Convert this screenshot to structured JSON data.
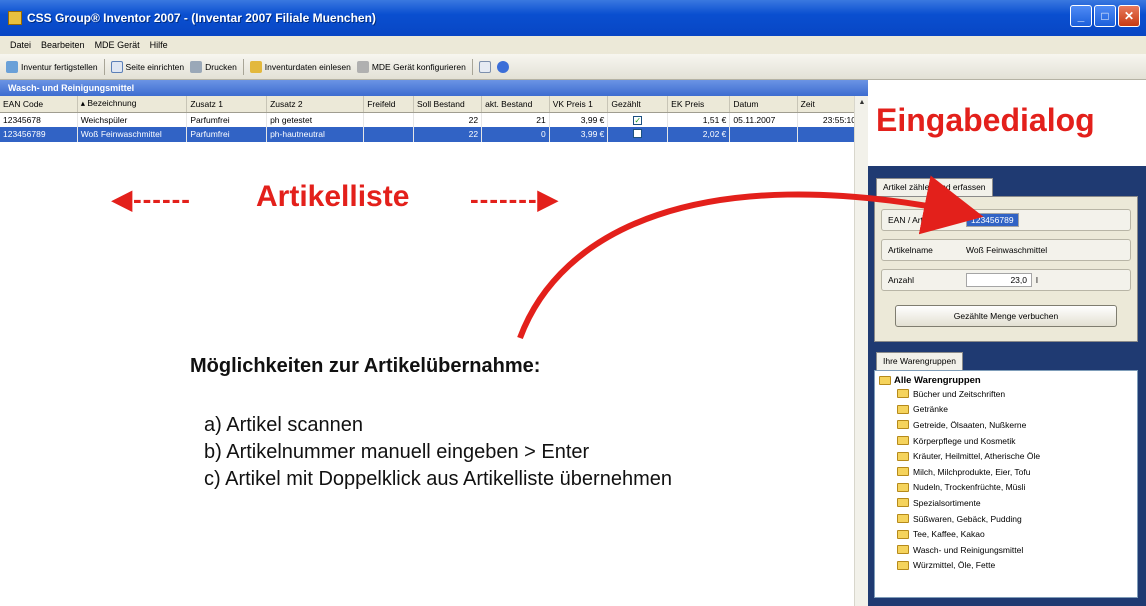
{
  "window": {
    "title": "CSS Group® Inventor 2007 - (Inventar 2007 Filiale Muenchen)"
  },
  "menu": [
    "Datei",
    "Bearbeiten",
    "MDE Gerät",
    "Hilfe"
  ],
  "toolbar": [
    {
      "label": "Inventur fertigstellen",
      "icon": "check-list-icon"
    },
    {
      "label": "Seite einrichten",
      "icon": "page-setup-icon"
    },
    {
      "label": "Drucken",
      "icon": "printer-icon"
    },
    {
      "label": "Inventurdaten einlesen",
      "icon": "import-icon"
    },
    {
      "label": "MDE Gerät konfigurieren",
      "icon": "device-config-icon"
    }
  ],
  "group_header": "Wasch- und Reinigungsmittel",
  "table": {
    "columns": [
      "EAN Code",
      "▴ Bezeichnung",
      "Zusatz 1",
      "Zusatz 2",
      "Freifeld",
      "Soll Bestand",
      "akt. Bestand",
      "VK Preis 1",
      "Gezählt",
      "EK Preis",
      "Datum",
      "Zeit"
    ],
    "rows": [
      {
        "ean": "12345678",
        "name": "Weichspüler",
        "z1": "Parfumfrei",
        "z2": "ph getestet",
        "frei": "",
        "soll": "22",
        "akt": "21",
        "vk": "3,99 €",
        "gezaehlt": true,
        "ek": "1,51 €",
        "datum": "05.11.2007",
        "zeit": "23:55:10"
      },
      {
        "ean": "123456789",
        "name": "Woß Feinwaschmittel",
        "z1": "Parfumfrei",
        "z2": "ph-hautneutral",
        "frei": "",
        "soll": "22",
        "akt": "0",
        "vk": "3,99 €",
        "gezaehlt": false,
        "ek": "2,02 €",
        "datum": "",
        "zeit": ""
      }
    ]
  },
  "annotations": {
    "artikelliste": "Artikelliste",
    "arrow_left": "◀------",
    "arrow_right": "-------▶",
    "heading": "Möglichkeiten zur Artikelübernahme:",
    "options": [
      "a)  Artikel scannen",
      "b)  Artikelnummer manuell eingeben > Enter",
      "c)  Artikel mit Doppelklick aus Artikelliste übernehmen"
    ],
    "eingabedialog": "Eingabedialog"
  },
  "dialog": {
    "tab": "Artikel zählen und erfassen",
    "ean_label": "EAN / ArtNr",
    "ean_value": "123456789",
    "name_label": "Artikelname",
    "name_value": "Woß Feinwaschmittel",
    "qty_label": "Anzahl",
    "qty_value": "23,0",
    "qty_unit": "l",
    "book_button": "Gezählte Menge verbuchen"
  },
  "groups": {
    "tab": "Ihre Warengruppen",
    "root": "Alle Warengruppen",
    "items": [
      "Bücher und Zeitschriften",
      "Getränke",
      "Getreide, Ölsaaten, Nußkerne",
      "Körperpflege und Kosmetik",
      "Kräuter, Heilmittel, Atherische Öle",
      "Milch, Milchprodukte, Eier, Tofu",
      "Nudeln, Trockenfrüchte, Müsli",
      "Spezialsortimente",
      "Süßwaren, Gebäck, Pudding",
      "Tee, Kaffee, Kakao",
      "Wasch- und Reinigungsmittel",
      "Würzmittel, Öle, Fette"
    ]
  }
}
